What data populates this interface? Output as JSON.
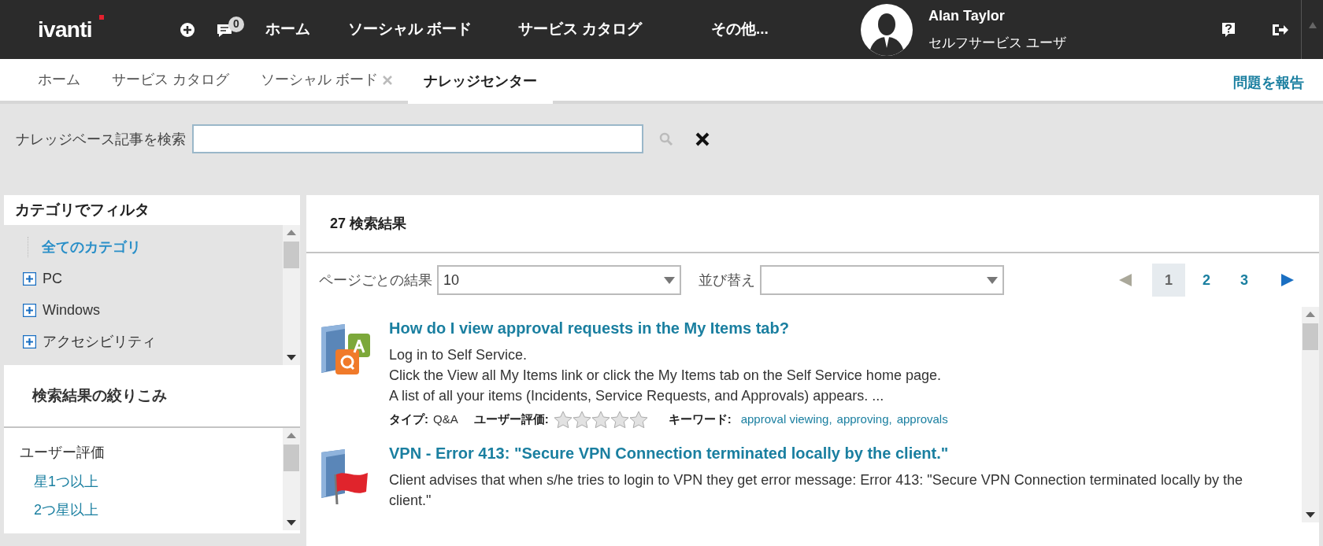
{
  "header": {
    "logo": "ivanti",
    "notification_count": "0",
    "nav": [
      "ホーム",
      "ソーシャル ボード",
      "サービス カタログ",
      "その他..."
    ],
    "user": {
      "name": "Alan Taylor",
      "role": "セルフサービス ユーザ"
    }
  },
  "tabs": [
    {
      "label": "ホーム",
      "selected": false,
      "closable": false
    },
    {
      "label": "サービス カタログ",
      "selected": false,
      "closable": false
    },
    {
      "label": "ソーシャル ボード",
      "selected": false,
      "closable": true
    },
    {
      "label": "ナレッジセンター",
      "selected": true,
      "closable": false
    }
  ],
  "report_link": "問題を報告",
  "search": {
    "label": "ナレッジベース記事を検索"
  },
  "category_filter": {
    "title": "カテゴリでフィルタ",
    "items": [
      {
        "label": "全てのカテゴリ",
        "kind": "root",
        "selected": true
      },
      {
        "label": "PC",
        "kind": "node",
        "expanded": false,
        "selected": false
      },
      {
        "label": "Windows",
        "kind": "node",
        "expanded": false,
        "selected": false
      },
      {
        "label": "アクセシビリティ",
        "kind": "node",
        "expanded": false,
        "selected": false
      }
    ]
  },
  "refine": {
    "title": "検索結果の絞りこみ",
    "groups": [
      {
        "label": "ユーザー評価",
        "options": [
          "星1つ以上",
          "2つ星以上"
        ]
      }
    ]
  },
  "results": {
    "count_label": "27 検索結果",
    "per_page": {
      "label": "ページごとの結果",
      "value": "10"
    },
    "sort": {
      "label": "並び替え"
    },
    "pagination": {
      "prev_disabled": true,
      "next_disabled": false,
      "pages": [
        {
          "label": "1",
          "selected": true
        },
        {
          "label": "2",
          "selected": false
        },
        {
          "label": "3",
          "selected": false
        }
      ]
    },
    "items": [
      {
        "kind": "qa",
        "title": "How do I view approval requests in the My Items tab?",
        "summary": [
          "Log in to Self Service.",
          "Click the View all My Items link or click the My Items tab on the Self Service home page.",
          "A list of all your items (Incidents, Service Requests, and Approvals) appears. ..."
        ],
        "meta": {
          "type_label": "タイプ:",
          "type": "Q&A",
          "rating_label": "ユーザー評価:",
          "stars": 0,
          "keywords_label": "キーワード:",
          "keywords": [
            "approval viewing,",
            "approving,",
            "approvals"
          ]
        }
      },
      {
        "kind": "flag",
        "title": "VPN - Error 413: \"Secure VPN Connection terminated locally by the client.\"",
        "summary": [
          "Client advises that when s/he tries to login to VPN they get error message: Error 413: \"Secure VPN Connection terminated locally by the client.\""
        ]
      }
    ]
  }
}
